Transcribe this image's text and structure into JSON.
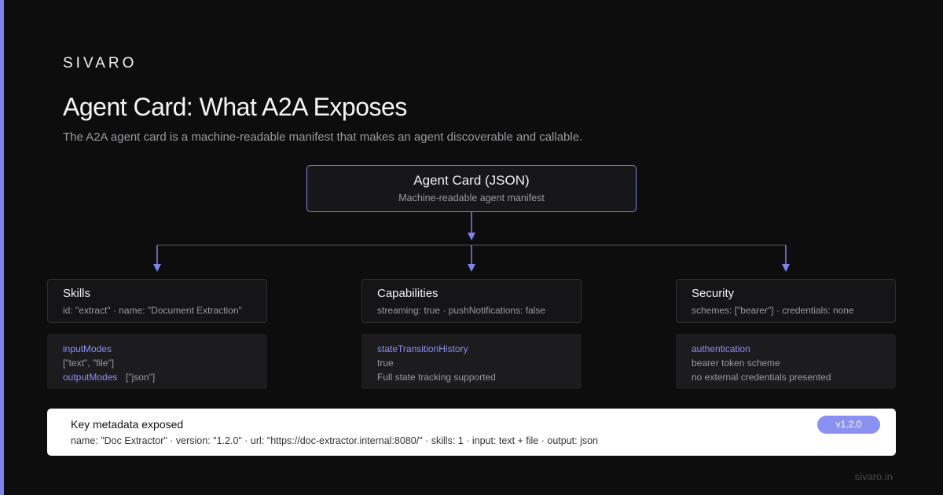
{
  "brand": "SIVARO",
  "title": "Agent Card: What A2A Exposes",
  "subtitle": "The A2A agent card is a machine-readable manifest that makes an agent discoverable and callable.",
  "colors": {
    "background": "#0d0d0d",
    "accent": "#7c83ea",
    "badge": "#8b91f0",
    "panel": "#ffffff"
  },
  "root": {
    "title": "Agent Card (JSON)",
    "subtitle": "Machine-readable agent manifest"
  },
  "branches": [
    {
      "title": "Skills",
      "desc": "id: \"extract\" · name: \"Document Extraction\"",
      "detail": {
        "key": "inputModes",
        "value": "[\"text\", \"file\"]",
        "key2": "outputModes",
        "value2": "[\"json\"]"
      }
    },
    {
      "title": "Capabilities",
      "desc": "streaming: true · pushNotifications: false",
      "detail": {
        "key": "stateTransitionHistory",
        "value": "true",
        "note": "Full state tracking supported"
      }
    },
    {
      "title": "Security",
      "desc": "schemes: [\"bearer\"] · credentials: none",
      "detail": {
        "key": "authentication",
        "value": "bearer token scheme",
        "note": "no external credentials presented"
      }
    }
  ],
  "metadata": {
    "title": "Key metadata exposed",
    "line": "name: \"Doc Extractor\" · version: \"1.2.0\" · url: \"https://doc-extractor.internal:8080/\" · skills: 1 · input: text + file · output: json",
    "badge": "v1.2.0"
  },
  "footer": "sivaro.in"
}
